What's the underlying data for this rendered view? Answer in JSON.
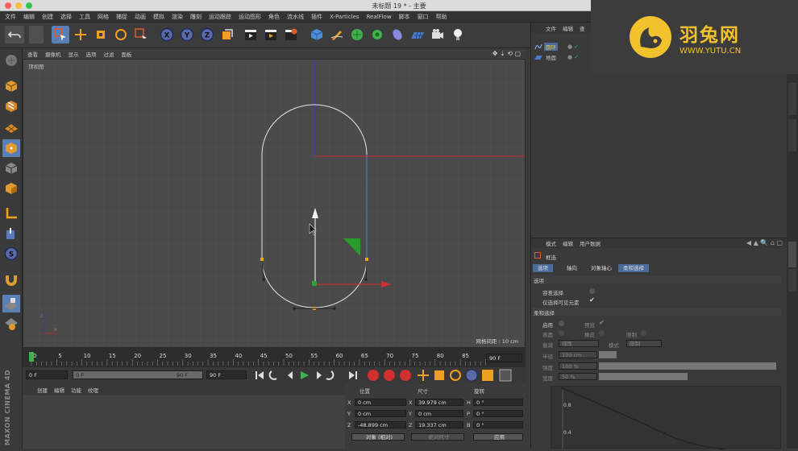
{
  "window": {
    "title": "未标题 19 * - 主要"
  },
  "menubar": [
    "文件",
    "编辑",
    "创建",
    "选择",
    "工具",
    "网格",
    "捕捉",
    "动画",
    "模拟",
    "渲染",
    "雕刻",
    "运动跟踪",
    "运动图形",
    "角色",
    "流水线",
    "插件",
    "X-Particles",
    "RealFlow",
    "脚本",
    "窗口",
    "帮助"
  ],
  "toolbar": {
    "undo_icon": "undo-icon",
    "axis_x": "X",
    "axis_y": "Y",
    "axis_z": "Z"
  },
  "viewport": {
    "menu": [
      "查看",
      "摄像机",
      "显示",
      "选项",
      "过滤",
      "面板"
    ],
    "label": "顶视图",
    "grid_info": "网格间距 : 10 cm"
  },
  "timeline": {
    "ticks": [
      "0",
      "5",
      "10",
      "15",
      "20",
      "25",
      "30",
      "35",
      "40",
      "45",
      "50",
      "55",
      "60",
      "65",
      "70",
      "75",
      "80",
      "85",
      "90"
    ],
    "current_frame": "0 F"
  },
  "transport": {
    "start": "0 F",
    "range_start": "0 F",
    "range_end": "90 F",
    "end": "90 F"
  },
  "material_menu": [
    "创建",
    "编辑",
    "功能",
    "纹理"
  ],
  "brand": {
    "vertical": "MAXON CINEMA 4D"
  },
  "coords": {
    "headers": [
      "位置",
      "尺寸",
      "旋转"
    ],
    "rows": [
      {
        "axis": "X",
        "pos": "0 cm",
        "size_axis": "X",
        "size": "39.979 cm",
        "rot_axis": "H",
        "rot": "0 °"
      },
      {
        "axis": "Y",
        "pos": "0 cm",
        "size_axis": "Y",
        "size": "0 cm",
        "rot_axis": "P",
        "rot": "0 °"
      },
      {
        "axis": "Z",
        "pos": "-48.899 cm",
        "size_axis": "Z",
        "size": "19.337 cm",
        "rot_axis": "B",
        "rot": "0 °"
      }
    ],
    "mode": "对象 (相对)",
    "size_mode": "绝对尺寸",
    "apply": "应用"
  },
  "object_manager": {
    "menu": [
      "文件",
      "编辑",
      "查"
    ],
    "objects": [
      {
        "name": "圆环"
      },
      {
        "name": "地面"
      }
    ]
  },
  "attributes": {
    "menu": [
      "模式",
      "编辑",
      "用户数据"
    ],
    "title": "框选",
    "tabs": [
      "选项",
      "轴向",
      "对象轴心",
      "柔和选择"
    ],
    "section1": "选项",
    "opt1": "容差选择",
    "opt2": "仅选择可见元素",
    "section2": "柔和选择",
    "enable": "启用",
    "preview": "预览",
    "surface": "表面",
    "rubber": "橡皮",
    "restrict": "限制",
    "falloff_label": "衰减",
    "falloff_value": "线性",
    "mode_label": "模式",
    "mode_value": "限制",
    "radius_label": "半径",
    "radius_value": "100 cm",
    "strength_label": "强度",
    "strength_value": "100 %",
    "width_label": "宽度",
    "width_value": "50 %",
    "graph_ticks": [
      "0.8",
      "0.4"
    ]
  },
  "logo": {
    "name": "羽兔网",
    "url": "WWW.YUTU.CN"
  }
}
